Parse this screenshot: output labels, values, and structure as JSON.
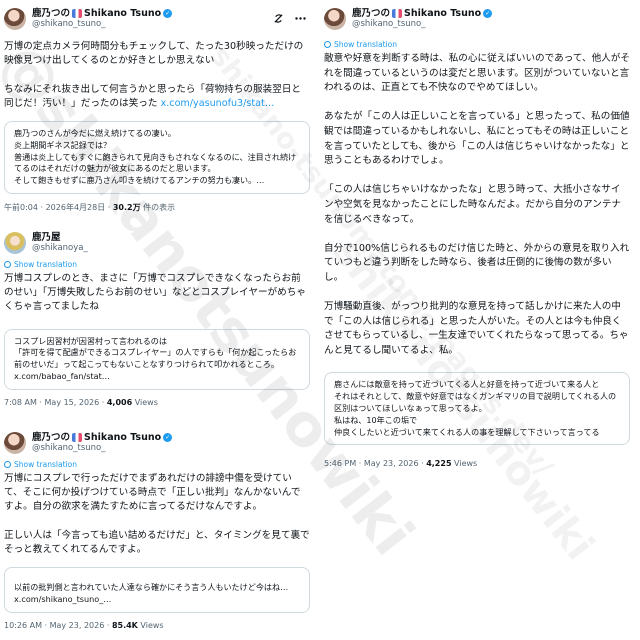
{
  "watermark": {
    "large": "@shikanotsunowiki",
    "medium": "shikano-tsunomatome.pages.dev/",
    "small": "shikanotsunowiki"
  },
  "tweets": [
    {
      "display_name": "鹿乃つの",
      "display_name_latin": "Shikano Tsuno",
      "handle": "@shikano_tsuno_",
      "body_main": "万博の定点カメラ何時間分もチェックして、たった30秒映っただけの映像見つけ出してくるのとか好きとしか思えない\n\nちなみにそれ抜き出して何言うかと思ったら「荷物持ちの服装翌日と同じだ！汚い！」だったのは笑った ",
      "body_link": "x.com/yasunofu3/stat…",
      "quote": "鹿乃つのさんが今だに燃え続けてるの凄い。\n炎上期間ギネス記録では？\n普通は炎上してもすぐに飽きられて見向きもされなくなるのに、注目され続けてるのはそれだけの魅力が彼女にあるのだと思います。\nそして飽きもせずに鹿乃さん叩きを続けてるアンチの努力も凄い。…",
      "time": "午前0:04 · 2026年4月28日 · ",
      "views_count": "30.2万",
      "views_label": " 件の表示"
    },
    {
      "display_name": "鹿乃屋",
      "handle": "@shikanoya_",
      "show_translation": "Show translation",
      "body_main": "万博コスプレのとき、まさに「万博でコスプレできなくなったらお前のせい」「万博失敗したらお前のせい」などとコスプレイヤーがめちゃくちゃ言ってましたね",
      "quote": "コスプレ因習村が因習村って言われるのは\n「許可を得て配慮ができるコスプレイヤー」の人ですらも「何か起こったらお前のせいだ」って起こってもないことなすりつけられて叩かれるところ。",
      "quote_link": "x.com/babao_fan/stat…",
      "time": "7:08 AM · May 15, 2026 · ",
      "views_count": "4,006",
      "views_label": " Views"
    },
    {
      "display_name": "鹿乃つの",
      "display_name_latin": "Shikano Tsuno",
      "handle": "@shikano_tsuno_",
      "show_translation": "Show translation",
      "body_main": "万博にコスプレで行っただけでまずあれだけの誹謗中傷を受けていて、そこに何か投げつけている時点で「正しい批判」なんかないんですよ。自分の欲求を満たすために言ってるだけなんですよ。\n\n正しい人は「今言っても追い詰めるだけだ」と、タイミングを見て裏でそっと教えてくれてるんですよ。",
      "quote": "以前の批判側と言われていた人達なら確かにそう言う人もいたけど今はね…",
      "quote_link": "x.com/shikano_tsuno_…",
      "time": "10:26 AM · May 23, 2026 · ",
      "views_count": "85.4K",
      "views_label": " Views"
    },
    {
      "display_name": "鹿乃つの",
      "display_name_latin": "Shikano Tsuno",
      "handle": "@shikano_tsuno_",
      "show_translation": "Show translation",
      "body_main": "敵意や好意を判断する時は、私の心に従えばいいのであって、他人がそれを間違っているというのは変だと思います。区別がついていないと言われるのは、正直とても不快なのでやめてほしい。\n\nあなたが「この人は正しいことを言っている」と思ったって、私の価値観では間違っているかもしれないし、私にとってもその時は正しいことを言っていたとしても、後から「この人は信じちゃいけなかったな」と思うこともあるわけでしょ。\n\n「この人は信じちゃいけなかったな」と思う時って、大抵小さなサインや空気を見なかったことにした時なんだよ。だから自分のアンテナを信じるべきなって。\n\n自分で100%信じられるものだけ信じた時と、外からの意見を取り入れていつもと違う判断をした時なら、後者は圧倒的に後悔の数が多いし。\n\n万博騒動直後、がっつり批判的な意見を持って話しかけに来た人の中で「この人は信じられる」と思った人がいた。その人とは今も仲良くさせてもらっているし、一生友達でいてくれたらなって思ってる。ちゃんと見てるし聞いてるよ、私。",
      "quote": "鹿さんには敵意を持って近づいてくる人と好意を持って近づいて来る人と\nそれはそれとして、敵意や好意ではなくガンギマリの目で説明してくれる人の区別はついてほしいなぁって思ってるよ。\n私はね、10年この垢で\n仲良くしたいと近づいて来てくれる人の事を理解して下さいって言ってる",
      "time": "5:46 PM · May 23, 2026 · ",
      "views_count": "4,225",
      "views_label": " Views"
    }
  ]
}
